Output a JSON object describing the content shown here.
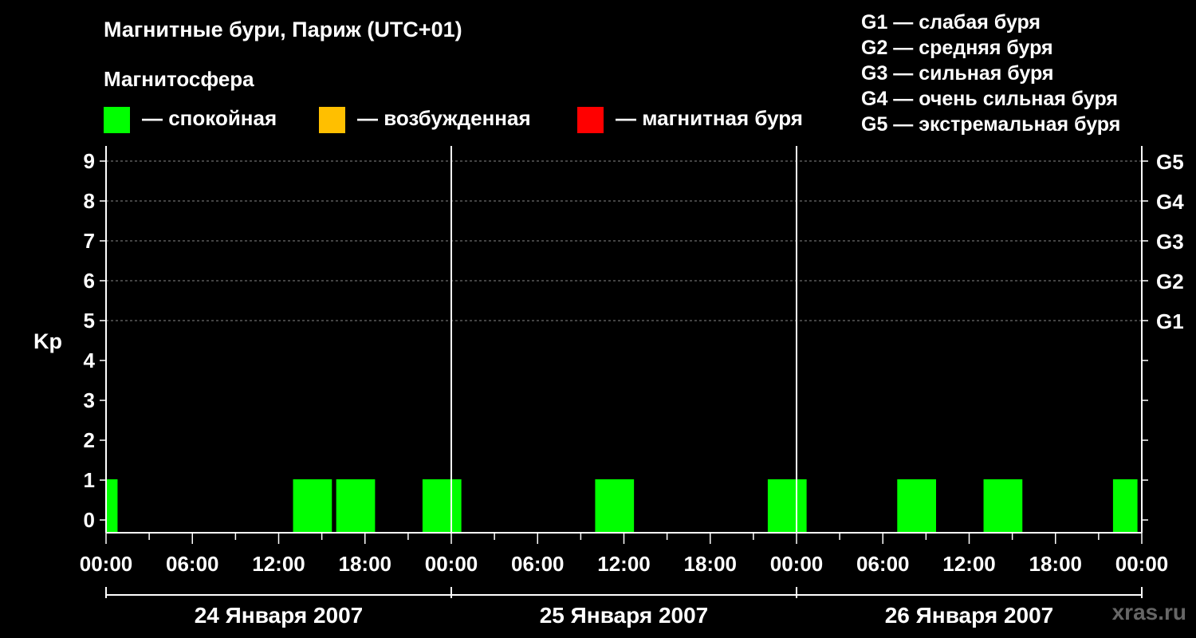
{
  "title": "Магнитные бури, Париж (UTC+01)",
  "subtitle": "Магнитосфера",
  "legend": [
    {
      "label": "— спокойная",
      "color": "#00ff00"
    },
    {
      "label": "— возбужденная",
      "color": "#ffbf00"
    },
    {
      "label": "— магнитная буря",
      "color": "#ff0000"
    }
  ],
  "storm_scale": [
    "G1 — слабая буря",
    "G2 — средняя буря",
    "G3 — сильная буря",
    "G4 — очень сильная буря",
    "G5 — экстремальная буря"
  ],
  "watermark": "xras.ru",
  "chart_data": {
    "type": "bar",
    "ylabel": "Kp",
    "ylim": [
      0,
      9
    ],
    "y_ticks": [
      0,
      1,
      2,
      3,
      4,
      5,
      6,
      7,
      8,
      9
    ],
    "right_axis": [
      {
        "kp": 5,
        "label": "G1"
      },
      {
        "kp": 6,
        "label": "G2"
      },
      {
        "kp": 7,
        "label": "G3"
      },
      {
        "kp": 8,
        "label": "G4"
      },
      {
        "kp": 9,
        "label": "G5"
      }
    ],
    "grid": "dashed at Kp 5–9",
    "x_range_hours": [
      0,
      72
    ],
    "x_tick_labels": [
      "00:00",
      "06:00",
      "12:00",
      "18:00",
      "00:00",
      "06:00",
      "12:00",
      "18:00",
      "00:00",
      "06:00",
      "12:00",
      "18:00",
      "00:00"
    ],
    "days": [
      "24 Января 2007",
      "25 Января 2007",
      "26 Января 2007"
    ],
    "colors": {
      "quiet": "#00ff00",
      "active": "#ffbf00",
      "storm": "#ff0000"
    },
    "bars": [
      {
        "start_h": 0,
        "end_h": 0.8,
        "kp": 1,
        "level": "quiet"
      },
      {
        "start_h": 13,
        "end_h": 15.7,
        "kp": 1,
        "level": "quiet"
      },
      {
        "start_h": 16,
        "end_h": 18.7,
        "kp": 1,
        "level": "quiet"
      },
      {
        "start_h": 22,
        "end_h": 24.7,
        "kp": 1,
        "level": "quiet"
      },
      {
        "start_h": 34,
        "end_h": 36.7,
        "kp": 1,
        "level": "quiet"
      },
      {
        "start_h": 46,
        "end_h": 48.7,
        "kp": 1,
        "level": "quiet"
      },
      {
        "start_h": 55,
        "end_h": 57.7,
        "kp": 1,
        "level": "quiet"
      },
      {
        "start_h": 61,
        "end_h": 63.7,
        "kp": 1,
        "level": "quiet"
      },
      {
        "start_h": 70,
        "end_h": 71.7,
        "kp": 1,
        "level": "quiet"
      }
    ]
  }
}
